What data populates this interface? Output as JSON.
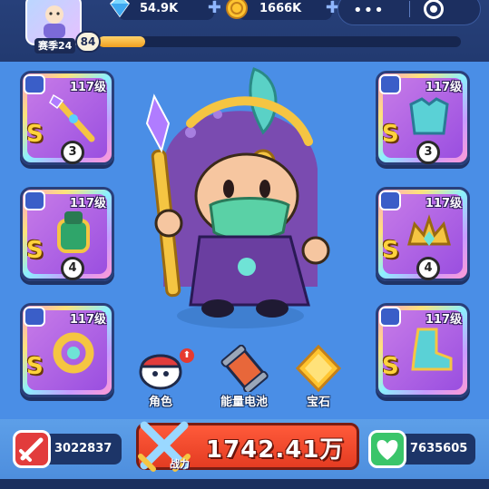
{
  "header": {
    "season_label": "赛季24",
    "player_level": "84",
    "xp_progress": 0.13,
    "diamonds": "54.9K",
    "coins": "1666K",
    "menu_dots": "•••"
  },
  "slots": [
    {
      "level": "117级",
      "grade": "S",
      "stars": "3",
      "item": "scepter-weapon"
    },
    {
      "level": "117级",
      "grade": "S",
      "stars": "3",
      "item": "armor-chest"
    },
    {
      "level": "117级",
      "grade": "S",
      "stars": "4",
      "item": "gauntlet"
    },
    {
      "level": "117级",
      "grade": "S",
      "stars": "4",
      "item": "crown-headgear"
    },
    {
      "level": "117级",
      "grade": "S",
      "stars": "",
      "item": "ring"
    },
    {
      "level": "117级",
      "grade": "S",
      "stars": "",
      "item": "boots"
    }
  ],
  "actions": {
    "character": "角色",
    "battery": "能量电池",
    "gem": "宝石"
  },
  "stats": {
    "attack": "3022837",
    "power": "1742.41万",
    "power_label": "战力",
    "health": "7635605"
  },
  "colors": {
    "background": "#4a8ee6",
    "power_panel": "#e43c22",
    "attack": "#e23c3c",
    "health": "#3ac56a"
  }
}
